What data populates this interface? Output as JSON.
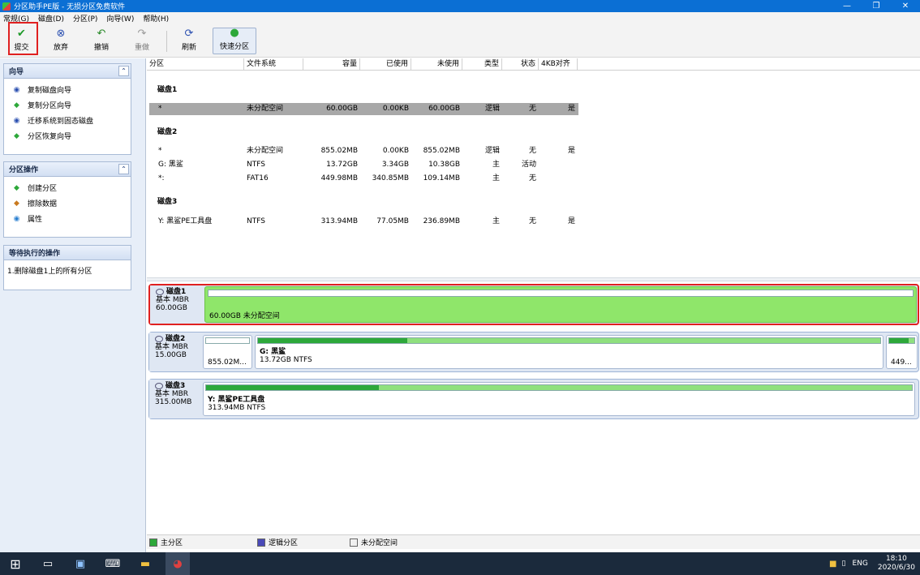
{
  "window": {
    "title": "分区助手PE版 - 无损分区免费软件",
    "controls": [
      "—",
      "❐",
      "✕"
    ]
  },
  "menu": [
    "常规(G)",
    "磁盘(D)",
    "分区(P)",
    "向导(W)",
    "帮助(H)"
  ],
  "toolbar": {
    "commit": "提交",
    "discard": "放弃",
    "undo": "撤销",
    "redo": "重做",
    "refresh": "刷新",
    "quick_partition": "快速分区"
  },
  "wizard_panel": {
    "title": "向导",
    "items": [
      "复制磁盘向导",
      "复制分区向导",
      "迁移系统到固态磁盘",
      "分区恢复向导"
    ]
  },
  "ops_panel": {
    "title": "分区操作",
    "items": [
      "创建分区",
      "擦除数据",
      "属性"
    ]
  },
  "pending_panel": {
    "title": "等待执行的操作",
    "items": [
      "1.删除磁盘1上的所有分区"
    ]
  },
  "grid": {
    "columns": [
      "分区",
      "文件系统",
      "容量",
      "已使用",
      "未使用",
      "类型",
      "状态",
      "4KB对齐"
    ],
    "disks": [
      {
        "name": "磁盘1",
        "rows": [
          [
            "*",
            "未分配空间",
            "60.00GB",
            "0.00KB",
            "60.00GB",
            "逻辑",
            "无",
            "是"
          ]
        ]
      },
      {
        "name": "磁盘2",
        "rows": [
          [
            "*",
            "未分配空间",
            "855.02MB",
            "0.00KB",
            "855.02MB",
            "逻辑",
            "无",
            "是"
          ],
          [
            "G: 黑鲨",
            "NTFS",
            "13.72GB",
            "3.34GB",
            "10.38GB",
            "主",
            "活动",
            ""
          ],
          [
            "*:",
            "FAT16",
            "449.98MB",
            "340.85MB",
            "109.14MB",
            "主",
            "无",
            ""
          ]
        ]
      },
      {
        "name": "磁盘3",
        "rows": [
          [
            "Y: 黑鲨PE工具盘",
            "NTFS",
            "313.94MB",
            "77.05MB",
            "236.89MB",
            "主",
            "无",
            "是"
          ]
        ]
      }
    ]
  },
  "map": {
    "disk1": {
      "name": "磁盘1",
      "type": "基本 MBR",
      "size": "60.00GB",
      "seg_label": "60.00GB 未分配空间"
    },
    "disk2": {
      "name": "磁盘2",
      "type": "基本 MBR",
      "size": "15.00GB",
      "seg1": "855.02M...",
      "seg2_name": "G: 黑鲨",
      "seg2_info": "13.72GB NTFS",
      "seg3": "449...",
      "seg2_used_fraction": 0.24,
      "seg3_used_fraction": 0.76
    },
    "disk3": {
      "name": "磁盘3",
      "type": "基本 MBR",
      "size": "315.00MB",
      "seg_name": "Y: 黑鲨PE工具盘",
      "seg_info": "313.94MB NTFS",
      "used_fraction": 0.245
    }
  },
  "legend": {
    "primary": "主分区",
    "logical": "逻辑分区",
    "unallocated": "未分配空间"
  },
  "colors": {
    "title_bar": "#0b6fd4",
    "primary": "#2da83a",
    "logical": "#4a4ab8",
    "selection": "#e02020"
  },
  "tray": {
    "lang": "ENG",
    "time": "18:10",
    "date": "2020/6/30"
  }
}
